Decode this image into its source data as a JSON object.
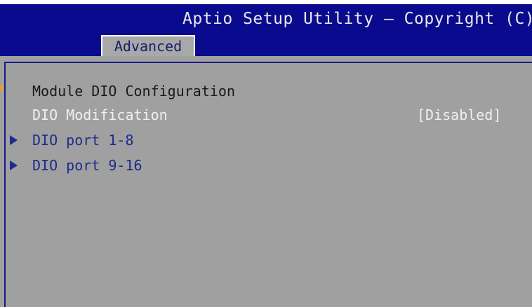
{
  "header": {
    "title": "Aptio Setup Utility – Copyright (C)",
    "active_tab": "Advanced"
  },
  "menu": {
    "heading": "Module DIO Configuration",
    "dio_modification": {
      "label": "DIO Modification",
      "value": "[Disabled]"
    },
    "submenus": [
      {
        "label": "DIO port 1-8"
      },
      {
        "label": "DIO port 9-16"
      }
    ]
  },
  "colors": {
    "header_bg": "#0a0a8e",
    "panel_bg": "#a0a0a0",
    "submenu_text": "#1d2b8a",
    "selected_text": "#f0f0f0"
  }
}
